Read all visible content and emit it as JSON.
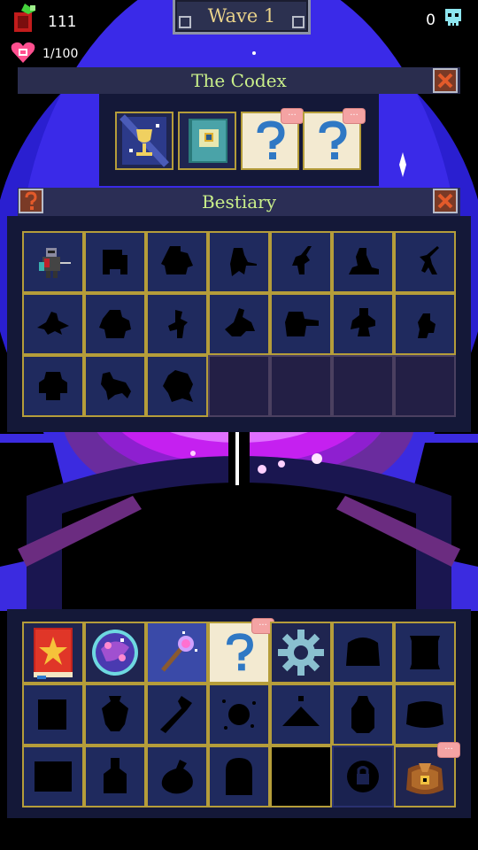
{
  "hud": {
    "currency_value": "111",
    "lives_value": "1/100",
    "souls_value": "0",
    "wave_label": "Wave 1"
  },
  "codex": {
    "title": "The Codex",
    "slots": [
      {
        "icon": "golden-chalice-card-icon",
        "badge": ""
      },
      {
        "icon": "blue-tome-icon",
        "badge": ""
      },
      {
        "icon": "question-card-icon",
        "badge": "..."
      },
      {
        "icon": "question-card-icon",
        "badge": "..."
      }
    ]
  },
  "bestiary": {
    "title": "Bestiary",
    "help_icon": "question-mark-icon",
    "entries": [
      "armored-knight-monster-icon",
      "beast-silhouette",
      "ogre-silhouette",
      "spearman-silhouette",
      "imp-silhouette",
      "crouching-creature-silhouette",
      "archer-silhouette",
      "crawler-silhouette",
      "brute-silhouette",
      "runner-silhouette",
      "rider-silhouette",
      "cannon-silhouette",
      "warrior-silhouette",
      "small-goblin-silhouette",
      "golem-silhouette",
      "wolf-silhouette",
      "wraith-silhouette",
      "empty",
      "empty",
      "empty",
      "empty"
    ]
  },
  "inventory": {
    "items": [
      {
        "icon": "red-spellbook-icon",
        "badge": ""
      },
      {
        "icon": "crystal-orb-icon",
        "badge": ""
      },
      {
        "icon": "magic-wand-icon",
        "badge": ""
      },
      {
        "icon": "question-card-icon",
        "badge": "..."
      },
      {
        "icon": "gear-cog-icon",
        "badge": ""
      },
      {
        "icon": "chest-silhouette",
        "badge": ""
      },
      {
        "icon": "scroll-silhouette",
        "badge": ""
      },
      {
        "icon": "map-silhouette",
        "badge": ""
      },
      {
        "icon": "vase-silhouette",
        "badge": ""
      },
      {
        "icon": "staff-silhouette",
        "badge": ""
      },
      {
        "icon": "aura-silhouette",
        "badge": ""
      },
      {
        "icon": "mountain-silhouette",
        "badge": ""
      },
      {
        "icon": "lantern-silhouette",
        "badge": ""
      },
      {
        "icon": "pouch-silhouette",
        "badge": ""
      },
      {
        "icon": "box-silhouette",
        "badge": ""
      },
      {
        "icon": "potion-silhouette",
        "badge": ""
      },
      {
        "icon": "bag-silhouette",
        "badge": ""
      },
      {
        "icon": "tombstone-silhouette",
        "badge": ""
      },
      {
        "icon": "empty-slot",
        "badge": ""
      },
      {
        "icon": "locked-slot-icon",
        "badge": ""
      },
      {
        "icon": "treasure-bag-icon",
        "badge": "..."
      }
    ]
  }
}
